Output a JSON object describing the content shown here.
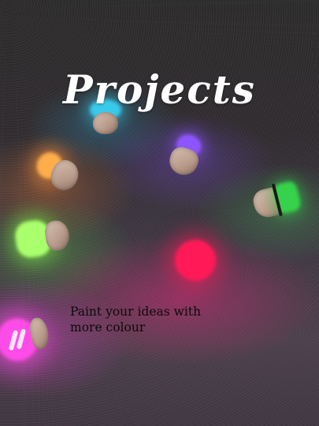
{
  "cover": {
    "title": "Projects",
    "tagline_line1": "Paint your ideas with",
    "tagline_line2": "more colour"
  },
  "lamps": [
    {
      "name": "cyan-lamp",
      "color": "#37c7e8"
    },
    {
      "name": "purple-lamp",
      "color": "#8a52ff"
    },
    {
      "name": "orange-lamp",
      "color": "#ffad4a"
    },
    {
      "name": "green-lamp-right",
      "color": "#34d34a"
    },
    {
      "name": "lime-lamp",
      "color": "#a8ff6a"
    },
    {
      "name": "red-lamp",
      "color": "#ff1a57"
    },
    {
      "name": "magenta-lamp",
      "color": "#ff4ce8"
    }
  ]
}
